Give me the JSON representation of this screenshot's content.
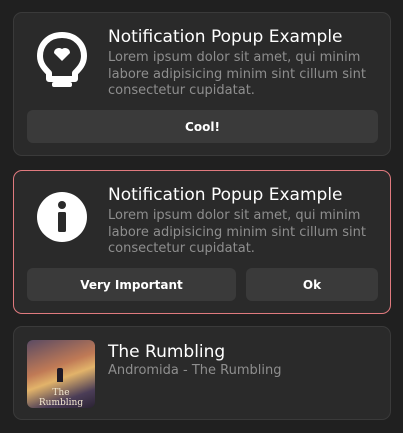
{
  "notifications": [
    {
      "icon": "lightbulb-icon",
      "title": "Notification Popup Example",
      "body": "Lorem ipsum dolor sit amet, qui minim labore adipisicing minim sint cillum sint consectetur cupidatat.",
      "actions": [
        "Cool!"
      ]
    },
    {
      "icon": "info-icon",
      "title": "Notification Popup Example",
      "body": "Lorem ipsum dolor sit amet, qui minim labore adipisicing minim sint cillum sint consectetur cupidatat.",
      "actions": [
        "Very Important",
        "Ok"
      ],
      "accent": "#e07a7e"
    }
  ],
  "media": {
    "title": "The Rumbling",
    "subtitle": "Andromida - The Rumbling",
    "cover_text": "The Rumbling"
  },
  "colors": {
    "background": "#202020",
    "card": "#2a2a2a",
    "button": "#3a3a3a",
    "muted_text": "#8e8e8e",
    "urgent_border": "#e07a7e"
  }
}
